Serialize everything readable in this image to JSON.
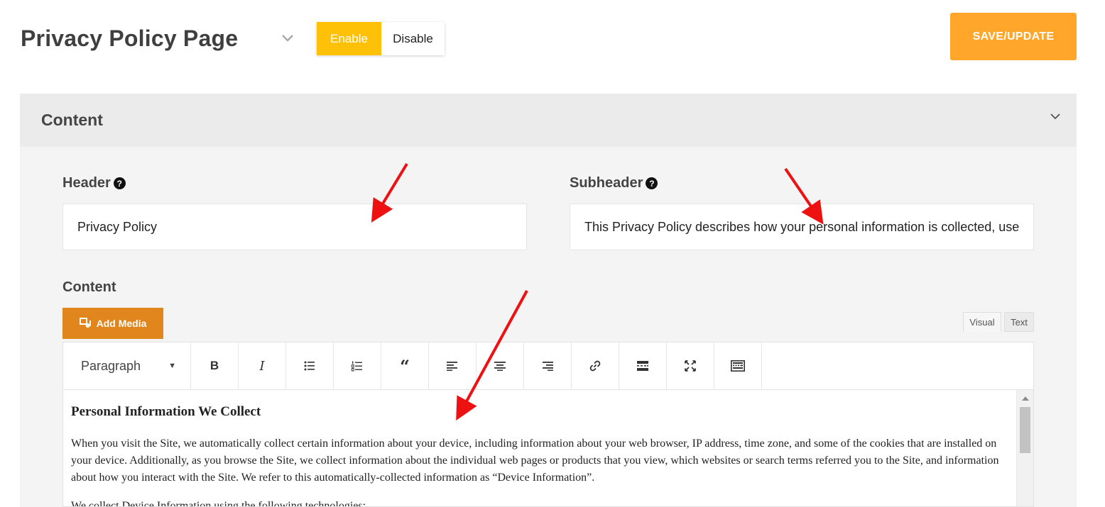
{
  "page": {
    "title": "Privacy Policy Page",
    "toggle": {
      "enable_label": "Enable",
      "disable_label": "Disable",
      "active": "enable"
    },
    "save_label": "SAVE/UPDATE"
  },
  "panel": {
    "title": "Content",
    "header_field": {
      "label": "Header",
      "value": "Privacy Policy"
    },
    "subheader_field": {
      "label": "Subheader",
      "value": "This Privacy Policy describes how your personal information is collected, used, and shared when you visit or make a purchase from the Site."
    },
    "content_field": {
      "label": "Content",
      "add_media_label": "Add Media",
      "tabs": {
        "visual": "Visual",
        "text": "Text"
      },
      "format_select": "Paragraph",
      "toolbar": {
        "bold": "B",
        "italic": "I",
        "blockquote": "“"
      },
      "editor": {
        "heading": "Personal Information We Collect",
        "paragraph1": "When you visit the Site, we automatically collect certain information about your device, including information about your web browser, IP address, time zone, and some of the cookies that are installed on your device. Additionally, as you browse the Site, we collect information about the individual web pages or products that you view, which websites or search terms referred you to the Site, and information about how you interact with the Site. We refer to this automatically-collected information as “Device Information”.",
        "paragraph2": "We collect Device Information using the following technologies:"
      }
    }
  },
  "colors": {
    "enable_active": "#ffc107",
    "save_button": "#ffa62b",
    "add_media": "#e0861c",
    "annotation_arrow": "#ee1111"
  },
  "icons": [
    "chevron-down-icon",
    "help-icon",
    "add-media-icon",
    "bullet-list-icon",
    "numbered-list-icon",
    "align-left-icon",
    "align-center-icon",
    "align-right-icon",
    "link-icon",
    "read-more-icon",
    "fullscreen-icon",
    "keyboard-icon"
  ]
}
